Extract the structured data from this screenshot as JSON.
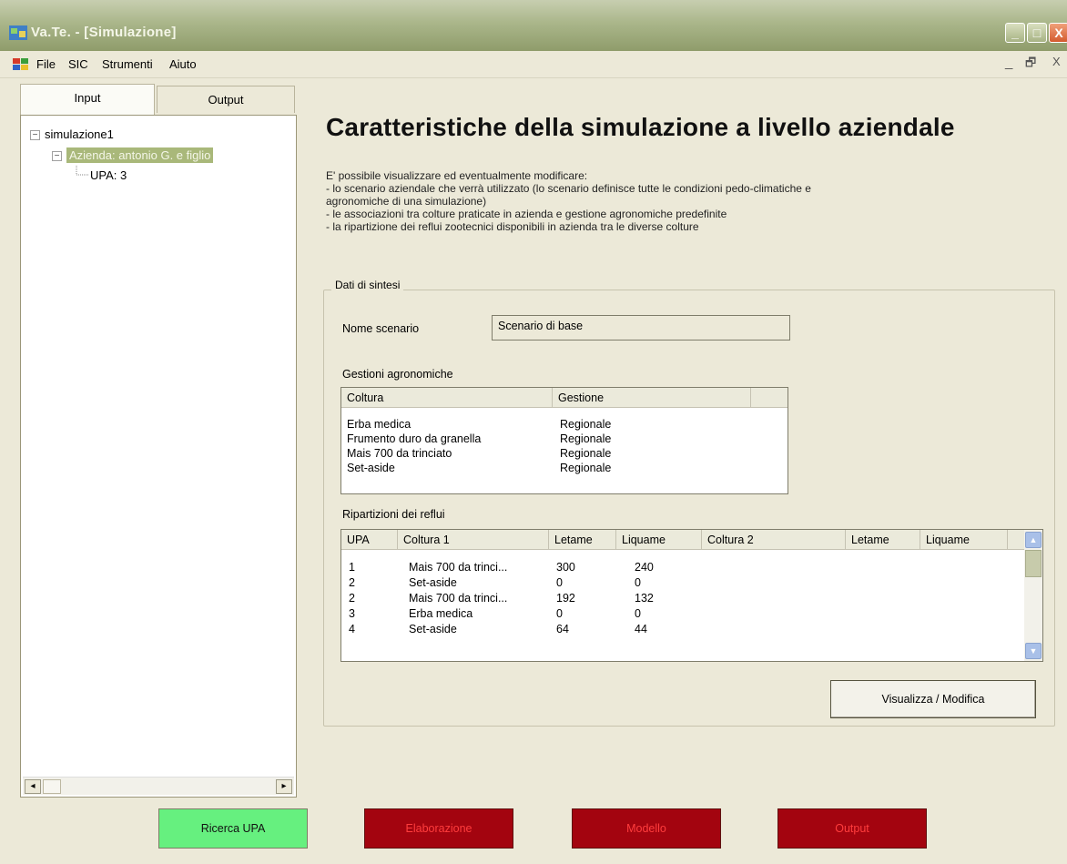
{
  "window": {
    "title": "Va.Te. - [Simulazione]",
    "accent_color": "#a9b87a",
    "min_glyph": "_",
    "max_glyph": "□",
    "close_glyph": "X"
  },
  "menu": {
    "items": [
      "File",
      "SIC",
      "Strumenti",
      "Aiuto"
    ],
    "mdi_min": "_",
    "mdi_restore": "🗗",
    "mdi_close": "X"
  },
  "tabs": [
    "Input",
    "Output"
  ],
  "tree": {
    "root": "simulazione1",
    "company": "Azienda: antonio G. e figlio",
    "upa": "UPA: 3",
    "collapse_glyph": "−",
    "left_arrow": "◂",
    "right_arrow": "▸"
  },
  "main": {
    "title": "Caratteristiche della simulazione a livello aziendale",
    "intro_lines": [
      "E' possibile visualizzare ed eventualmente modificare:",
      "- lo scenario aziendale che verrà utilizzato (lo scenario definisce tutte le condizioni pedo-climatiche e",
      "agronomiche di una simulazione)",
      "- le associazioni tra colture praticate in azienda e gestione agronomiche predefinite",
      "- la ripartizione dei reflui zootecnici disponibili in azienda tra le diverse colture"
    ],
    "group_title": "Dati di sintesi",
    "scenario_label": "Nome scenario",
    "scenario_value": "Scenario di base",
    "gestioni_label": "Gestioni agronomiche",
    "gestioni": {
      "columns": [
        "Coltura",
        "Gestione",
        ""
      ],
      "rows": [
        [
          "Erba medica",
          "Regionale"
        ],
        [
          "Frumento duro da granella",
          "Regionale"
        ],
        [
          "Mais 700 da trinciato",
          "Regionale"
        ],
        [
          "Set-aside",
          "Regionale"
        ]
      ]
    },
    "ripartizioni_label": "Ripartizioni dei reflui",
    "ripartizioni": {
      "columns": [
        "UPA",
        "Coltura 1",
        "Letame",
        "Liquame",
        "Coltura 2",
        "Letame",
        "Liquame"
      ],
      "rows": [
        [
          "1",
          "Mais 700 da trinci...",
          "300",
          "240"
        ],
        [
          "2",
          "Set-aside",
          "0",
          "0"
        ],
        [
          "2",
          "Mais 700 da trinci...",
          "192",
          "132"
        ],
        [
          "3",
          "Erba medica",
          "0",
          "0"
        ],
        [
          "4",
          "Set-aside",
          "64",
          "44"
        ]
      ],
      "up_arrow": "▲",
      "down_arrow": "▼"
    },
    "action_button": "Visualizza / Modifica"
  },
  "bottom_buttons": [
    {
      "label": "Ricerca UPA",
      "color": "#66f07f"
    },
    {
      "label": "Elaborazione",
      "color": "#a3040f"
    },
    {
      "label": "Modello",
      "color": "#a3040f"
    },
    {
      "label": "Output",
      "color": "#a3040f"
    }
  ]
}
